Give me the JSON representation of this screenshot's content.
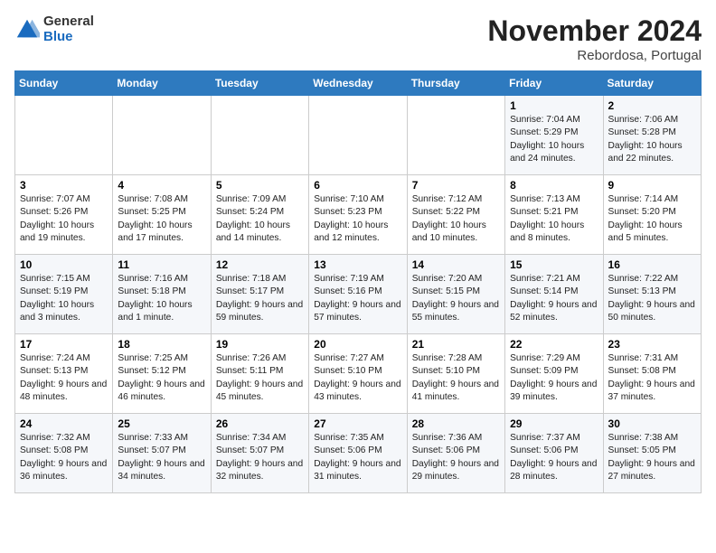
{
  "header": {
    "logo": {
      "general": "General",
      "blue": "Blue"
    },
    "title": "November 2024",
    "location": "Rebordosa, Portugal"
  },
  "weekdays": [
    "Sunday",
    "Monday",
    "Tuesday",
    "Wednesday",
    "Thursday",
    "Friday",
    "Saturday"
  ],
  "weeks": [
    [
      {
        "day": "",
        "info": ""
      },
      {
        "day": "",
        "info": ""
      },
      {
        "day": "",
        "info": ""
      },
      {
        "day": "",
        "info": ""
      },
      {
        "day": "",
        "info": ""
      },
      {
        "day": "1",
        "info": "Sunrise: 7:04 AM\nSunset: 5:29 PM\nDaylight: 10 hours and 24 minutes."
      },
      {
        "day": "2",
        "info": "Sunrise: 7:06 AM\nSunset: 5:28 PM\nDaylight: 10 hours and 22 minutes."
      }
    ],
    [
      {
        "day": "3",
        "info": "Sunrise: 7:07 AM\nSunset: 5:26 PM\nDaylight: 10 hours and 19 minutes."
      },
      {
        "day": "4",
        "info": "Sunrise: 7:08 AM\nSunset: 5:25 PM\nDaylight: 10 hours and 17 minutes."
      },
      {
        "day": "5",
        "info": "Sunrise: 7:09 AM\nSunset: 5:24 PM\nDaylight: 10 hours and 14 minutes."
      },
      {
        "day": "6",
        "info": "Sunrise: 7:10 AM\nSunset: 5:23 PM\nDaylight: 10 hours and 12 minutes."
      },
      {
        "day": "7",
        "info": "Sunrise: 7:12 AM\nSunset: 5:22 PM\nDaylight: 10 hours and 10 minutes."
      },
      {
        "day": "8",
        "info": "Sunrise: 7:13 AM\nSunset: 5:21 PM\nDaylight: 10 hours and 8 minutes."
      },
      {
        "day": "9",
        "info": "Sunrise: 7:14 AM\nSunset: 5:20 PM\nDaylight: 10 hours and 5 minutes."
      }
    ],
    [
      {
        "day": "10",
        "info": "Sunrise: 7:15 AM\nSunset: 5:19 PM\nDaylight: 10 hours and 3 minutes."
      },
      {
        "day": "11",
        "info": "Sunrise: 7:16 AM\nSunset: 5:18 PM\nDaylight: 10 hours and 1 minute."
      },
      {
        "day": "12",
        "info": "Sunrise: 7:18 AM\nSunset: 5:17 PM\nDaylight: 9 hours and 59 minutes."
      },
      {
        "day": "13",
        "info": "Sunrise: 7:19 AM\nSunset: 5:16 PM\nDaylight: 9 hours and 57 minutes."
      },
      {
        "day": "14",
        "info": "Sunrise: 7:20 AM\nSunset: 5:15 PM\nDaylight: 9 hours and 55 minutes."
      },
      {
        "day": "15",
        "info": "Sunrise: 7:21 AM\nSunset: 5:14 PM\nDaylight: 9 hours and 52 minutes."
      },
      {
        "day": "16",
        "info": "Sunrise: 7:22 AM\nSunset: 5:13 PM\nDaylight: 9 hours and 50 minutes."
      }
    ],
    [
      {
        "day": "17",
        "info": "Sunrise: 7:24 AM\nSunset: 5:13 PM\nDaylight: 9 hours and 48 minutes."
      },
      {
        "day": "18",
        "info": "Sunrise: 7:25 AM\nSunset: 5:12 PM\nDaylight: 9 hours and 46 minutes."
      },
      {
        "day": "19",
        "info": "Sunrise: 7:26 AM\nSunset: 5:11 PM\nDaylight: 9 hours and 45 minutes."
      },
      {
        "day": "20",
        "info": "Sunrise: 7:27 AM\nSunset: 5:10 PM\nDaylight: 9 hours and 43 minutes."
      },
      {
        "day": "21",
        "info": "Sunrise: 7:28 AM\nSunset: 5:10 PM\nDaylight: 9 hours and 41 minutes."
      },
      {
        "day": "22",
        "info": "Sunrise: 7:29 AM\nSunset: 5:09 PM\nDaylight: 9 hours and 39 minutes."
      },
      {
        "day": "23",
        "info": "Sunrise: 7:31 AM\nSunset: 5:08 PM\nDaylight: 9 hours and 37 minutes."
      }
    ],
    [
      {
        "day": "24",
        "info": "Sunrise: 7:32 AM\nSunset: 5:08 PM\nDaylight: 9 hours and 36 minutes."
      },
      {
        "day": "25",
        "info": "Sunrise: 7:33 AM\nSunset: 5:07 PM\nDaylight: 9 hours and 34 minutes."
      },
      {
        "day": "26",
        "info": "Sunrise: 7:34 AM\nSunset: 5:07 PM\nDaylight: 9 hours and 32 minutes."
      },
      {
        "day": "27",
        "info": "Sunrise: 7:35 AM\nSunset: 5:06 PM\nDaylight: 9 hours and 31 minutes."
      },
      {
        "day": "28",
        "info": "Sunrise: 7:36 AM\nSunset: 5:06 PM\nDaylight: 9 hours and 29 minutes."
      },
      {
        "day": "29",
        "info": "Sunrise: 7:37 AM\nSunset: 5:06 PM\nDaylight: 9 hours and 28 minutes."
      },
      {
        "day": "30",
        "info": "Sunrise: 7:38 AM\nSunset: 5:05 PM\nDaylight: 9 hours and 27 minutes."
      }
    ]
  ]
}
